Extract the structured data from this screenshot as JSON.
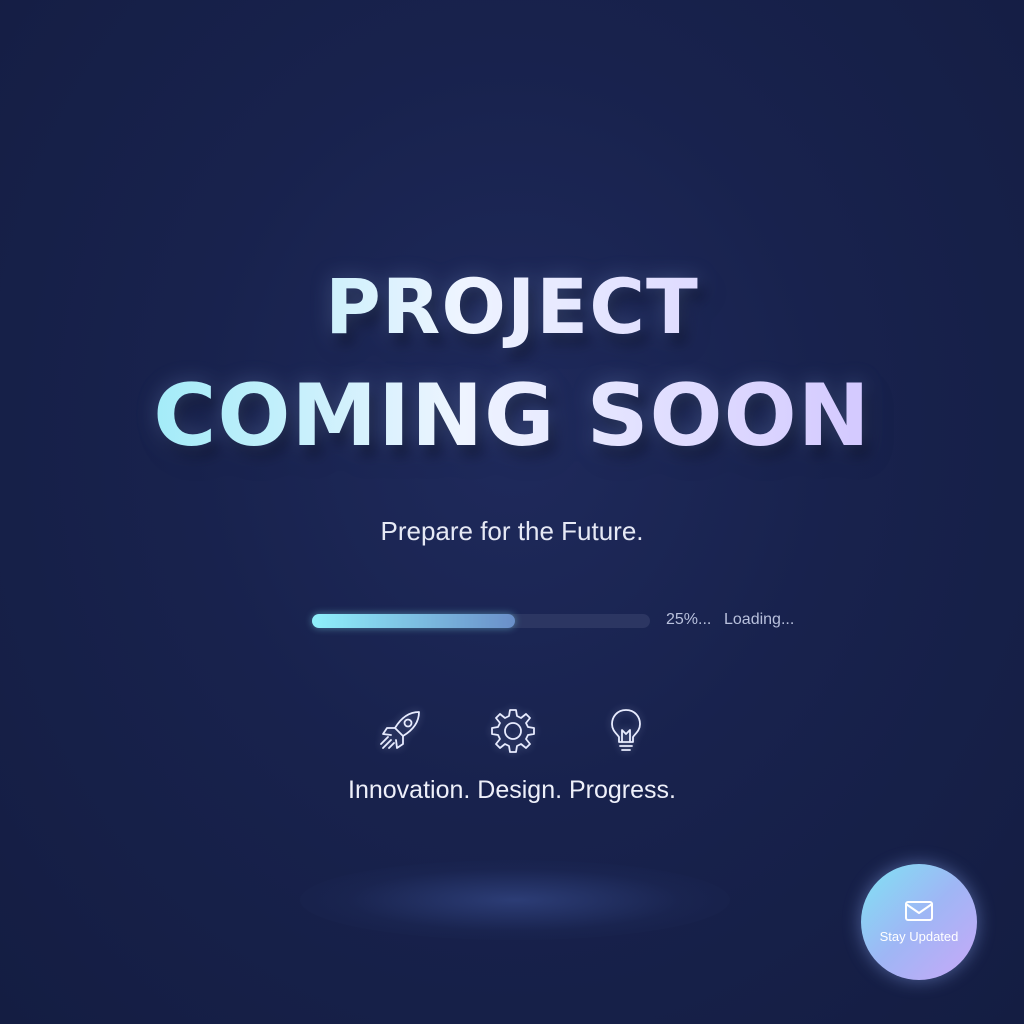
{
  "hero": {
    "title_line1": "PROJECT",
    "title_line2": "COMING SOON",
    "tagline": "Prepare for the Future."
  },
  "progress": {
    "value": 0.6,
    "percent_label": "25%...",
    "status_label": "Loading..."
  },
  "features": {
    "icons": [
      "rocket-icon",
      "gear-icon",
      "lightbulb-icon"
    ],
    "caption": "Innovation. Design. Progress."
  },
  "cta": {
    "label": "Stay Updated",
    "icon": "mail-icon"
  },
  "colors": {
    "background": "#18224d",
    "accent_cyan": "#7ee8f5",
    "accent_violet": "#c9a8f8",
    "track": "#2c3662"
  }
}
